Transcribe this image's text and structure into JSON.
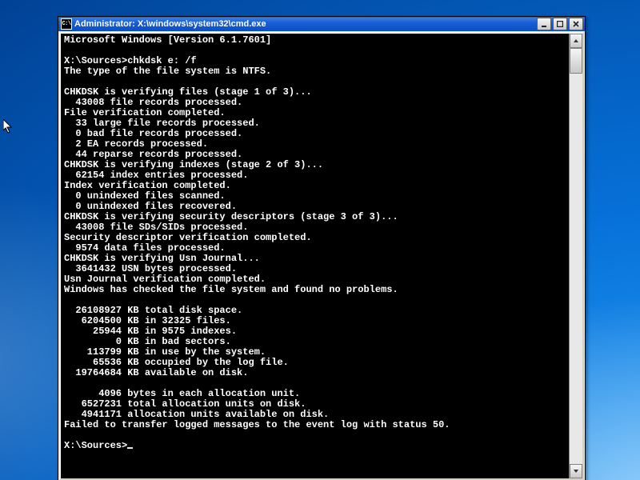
{
  "titlebar": {
    "icon_text": "C:\\",
    "prefix": "Administrator: ",
    "path": "X:\\windows\\system32\\cmd.exe"
  },
  "console": {
    "header": "Microsoft Windows [Version 6.1.7601]",
    "prompt_path": "X:\\Sources>",
    "command": "chkdsk e: /f",
    "lines": [
      "The type of the file system is NTFS.",
      "",
      "CHKDSK is verifying files (stage 1 of 3)...",
      "  43008 file records processed.",
      "File verification completed.",
      "  33 large file records processed.",
      "  0 bad file records processed.",
      "  2 EA records processed.",
      "  44 reparse records processed.",
      "CHKDSK is verifying indexes (stage 2 of 3)...",
      "  62154 index entries processed.",
      "Index verification completed.",
      "  0 unindexed files scanned.",
      "  0 unindexed files recovered.",
      "CHKDSK is verifying security descriptors (stage 3 of 3)...",
      "  43008 file SDs/SIDs processed.",
      "Security descriptor verification completed.",
      "  9574 data files processed.",
      "CHKDSK is verifying Usn Journal...",
      "  3641432 USN bytes processed.",
      "Usn Journal verification completed.",
      "Windows has checked the file system and found no problems.",
      "",
      "  26108927 KB total disk space.",
      "   6204500 KB in 32325 files.",
      "     25944 KB in 9575 indexes.",
      "         0 KB in bad sectors.",
      "    113799 KB in use by the system.",
      "     65536 KB occupied by the log file.",
      "  19764684 KB available on disk.",
      "",
      "      4096 bytes in each allocation unit.",
      "   6527231 total allocation units on disk.",
      "   4941171 allocation units available on disk.",
      "Failed to transfer logged messages to the event log with status 50."
    ],
    "prompt_final": "X:\\Sources>"
  }
}
